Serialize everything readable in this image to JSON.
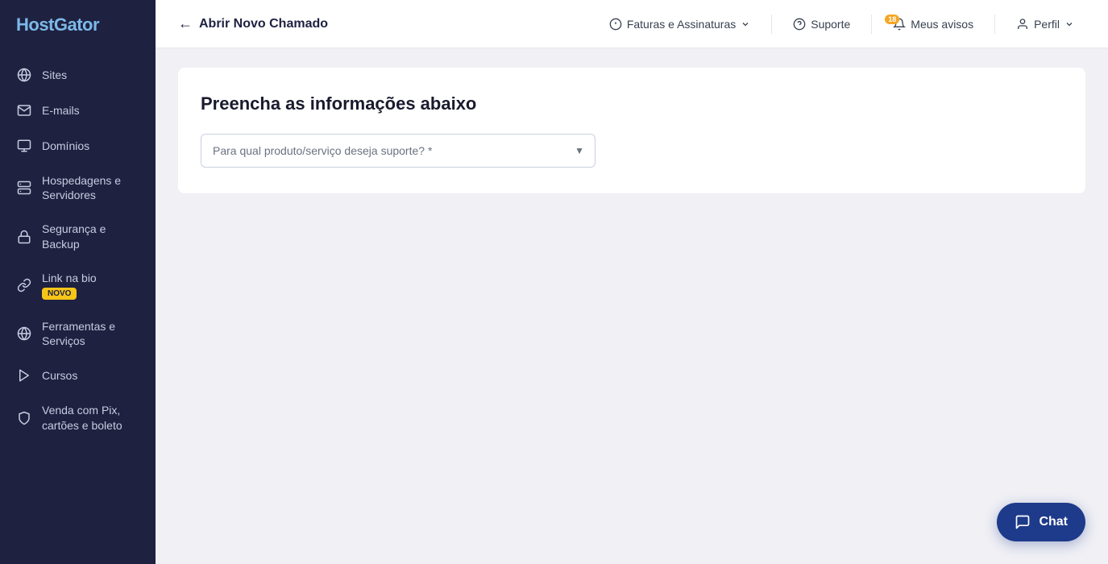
{
  "brand": "HostGator",
  "sidebar": {
    "items": [
      {
        "id": "sites",
        "label": "Sites",
        "icon": "globe"
      },
      {
        "id": "emails",
        "label": "E-mails",
        "icon": "email"
      },
      {
        "id": "dominios",
        "label": "Domínios",
        "icon": "domain"
      },
      {
        "id": "hospedagens",
        "label": "Hospedagens e Servidores",
        "icon": "server"
      },
      {
        "id": "seguranca",
        "label": "Segurança e Backup",
        "icon": "lock"
      },
      {
        "id": "linknabio",
        "label": "Link na bio",
        "icon": "link",
        "badge": "NOVO"
      },
      {
        "id": "ferramentas",
        "label": "Ferramentas e Serviços",
        "icon": "tools"
      },
      {
        "id": "cursos",
        "label": "Cursos",
        "icon": "play"
      },
      {
        "id": "venda",
        "label": "Venda com Pix, cartões e boleto",
        "icon": "shield"
      }
    ]
  },
  "topbar": {
    "back_label": "Abrir Novo Chamado",
    "faturas_label": "Faturas e Assinaturas",
    "suporte_label": "Suporte",
    "avisos_label": "Meus avisos",
    "avisos_count": "18",
    "perfil_label": "Perfil"
  },
  "form": {
    "title": "Preencha as informações abaixo",
    "select_placeholder": "Para qual produto/serviço deseja suporte? *"
  },
  "chat": {
    "label": "Chat"
  }
}
